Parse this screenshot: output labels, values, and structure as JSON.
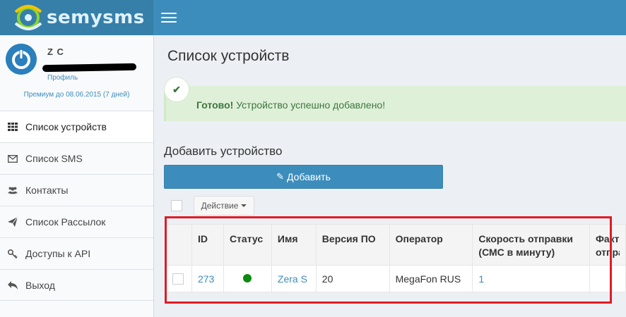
{
  "brand": {
    "logo_text": "semysms"
  },
  "user": {
    "name": "Z C",
    "profile_link": "Профиль",
    "premium": "Премиум до 08.06.2015 (7 дней)"
  },
  "sidebar": {
    "items": [
      {
        "label": "Список устройств",
        "icon": "grid-icon",
        "active": true
      },
      {
        "label": "Список SMS",
        "icon": "envelope-icon"
      },
      {
        "label": "Контакты",
        "icon": "users-icon"
      },
      {
        "label": "Список Рассылок",
        "icon": "paper-plane-icon"
      },
      {
        "label": "Доступы к API",
        "icon": "key-icon"
      },
      {
        "label": "Выход",
        "icon": "reply-icon"
      }
    ]
  },
  "page": {
    "title": "Список устройств",
    "alert": {
      "strong": "Готово!",
      "text": " Устройство успешно добавлено!"
    },
    "add_section_title": "Добавить устройство",
    "add_button": "Добавить",
    "action_button": "Действие"
  },
  "table": {
    "headers": [
      "ID",
      "Статус",
      "Имя",
      "Версия ПО",
      "Оператор",
      "Скорость отправки (СМС в минуту)",
      "Факти отпра"
    ],
    "row": {
      "id": "273",
      "status_color": "#0d8a10",
      "name": "Zera S",
      "version": "20",
      "operator": "MegaFon RUS",
      "speed": "1",
      "actual": ""
    }
  },
  "colors": {
    "primary": "#3c8dbc",
    "success_bg": "#dff0d8",
    "highlight_frame": "#e01b24"
  }
}
